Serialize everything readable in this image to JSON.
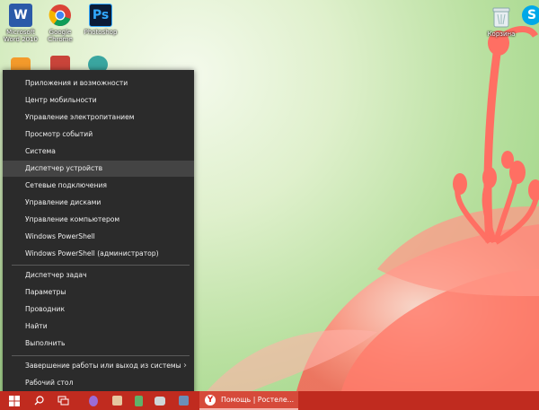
{
  "desktop": {
    "icons": [
      {
        "label_line1": "Microsoft",
        "label_line2": "Word 2010",
        "icon": "word-icon",
        "color": "#2b5aa8",
        "glyph": "W"
      },
      {
        "label_line1": "Google",
        "label_line2": "Chrome",
        "icon": "chrome-icon"
      },
      {
        "label_line1": "Photoshop",
        "label_line2": "",
        "icon": "photoshop-icon",
        "color": "#0a1c37",
        "glyph": "Ps"
      },
      {
        "label_line1": "Корзина",
        "label_line2": "",
        "icon": "recycle-bin-icon"
      },
      {
        "label_line1": "S",
        "label_line2": "",
        "icon": "skype-icon",
        "color": "#00a8e8"
      }
    ]
  },
  "context_menu": {
    "group1": [
      {
        "label": "Приложения и возможности"
      },
      {
        "label": "Центр мобильности"
      },
      {
        "label": "Управление электропитанием"
      },
      {
        "label": "Просмотр событий"
      },
      {
        "label": "Система"
      },
      {
        "label": "Диспетчер устройств",
        "highlighted": true
      },
      {
        "label": "Сетевые подключения"
      },
      {
        "label": "Управление дисками"
      },
      {
        "label": "Управление компьютером"
      },
      {
        "label": "Windows PowerShell"
      },
      {
        "label": "Windows PowerShell (администратор)"
      }
    ],
    "group2": [
      {
        "label": "Диспетчер задач"
      },
      {
        "label": "Параметры"
      },
      {
        "label": "Проводник"
      },
      {
        "label": "Найти"
      },
      {
        "label": "Выполнить"
      }
    ],
    "group3": [
      {
        "label": "Завершение работы или выход из системы",
        "has_submenu": true
      },
      {
        "label": "Рабочий стол"
      }
    ]
  },
  "taskbar": {
    "color": "#c02b1f",
    "active_app_label": "Помощь | Ростеле...",
    "active_app_icon": "yandex-browser-icon"
  }
}
